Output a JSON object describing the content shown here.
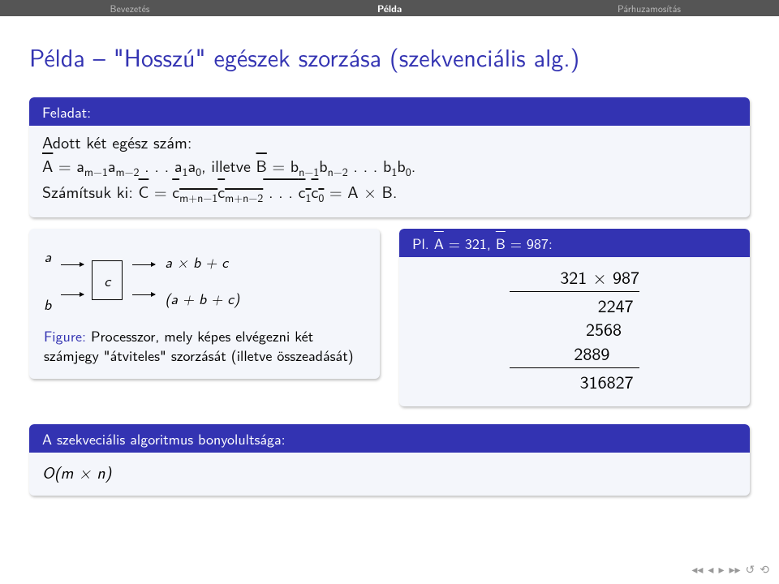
{
  "tabs": {
    "t0": "Bevezetés",
    "t1": "Példa",
    "t2": "Párhuzamosítás"
  },
  "title": "Példa – \"Hosszú\" egészek szorzása (szekvenciális alg.)",
  "task": {
    "heading": "Feladat:",
    "line1_prefix": "Adott két egész szám:",
    "a_def_lhs": "A",
    "a_def_rhs": " = a",
    "a_sub1": "m−1",
    "a_mid": "a",
    "a_sub2": "m−2",
    "dots": " . . . ",
    "a_end1": "a",
    "a_endsub1": "1",
    "a_end2": "a",
    "a_endsub2": "0",
    "illetve": ", illetve ",
    "b_def_lhs": "B",
    "b_def_rhs": " = b",
    "b_sub1": "n−1",
    "b_mid": "b",
    "b_sub2": "n−2",
    "b_end1": "b",
    "b_endsub1": "1",
    "b_end2": "b",
    "b_endsub2": "0",
    "period": ".",
    "line2_prefix": "Számítsuk ki: ",
    "c_lhs": "C",
    "c_eq": " = ",
    "c_part1": "c",
    "c_sub1": "m+n−1",
    "c_part2": "c",
    "c_sub2": "m+n−2",
    "c_end1": "c",
    "c_endsub1": "1",
    "c_end2": "c",
    "c_endsub2": "0",
    "c_tail": " = A × B."
  },
  "figure": {
    "in_a": "a",
    "in_b": "b",
    "box": "c",
    "out1": "a × b + c",
    "out2": "(a + b + c)",
    "caption_lead": "Figure:",
    "caption_text": " Processzor, mely képes elvégezni két számjegy \"átviteles\" szorzását (illetve összeadását)"
  },
  "example": {
    "heading_pre": "Pl. ",
    "A_lbl": "A",
    "A_val": " = 321, ",
    "B_lbl": "B",
    "B_val": " = 987:",
    "r1": "321 × 987",
    "r2": "2247 ",
    "r3": "2568   ",
    "r4": "2889     ",
    "r5": "316827 "
  },
  "complexity": {
    "heading": "A szekveciális algoritmus bonyolultsága:",
    "value": "O(m × n)"
  },
  "nav": {
    "i1": "◂◂",
    "i2": "◂",
    "i3": "▸",
    "i4": "▸▸",
    "i5": "↺",
    "i6": "⟲"
  }
}
